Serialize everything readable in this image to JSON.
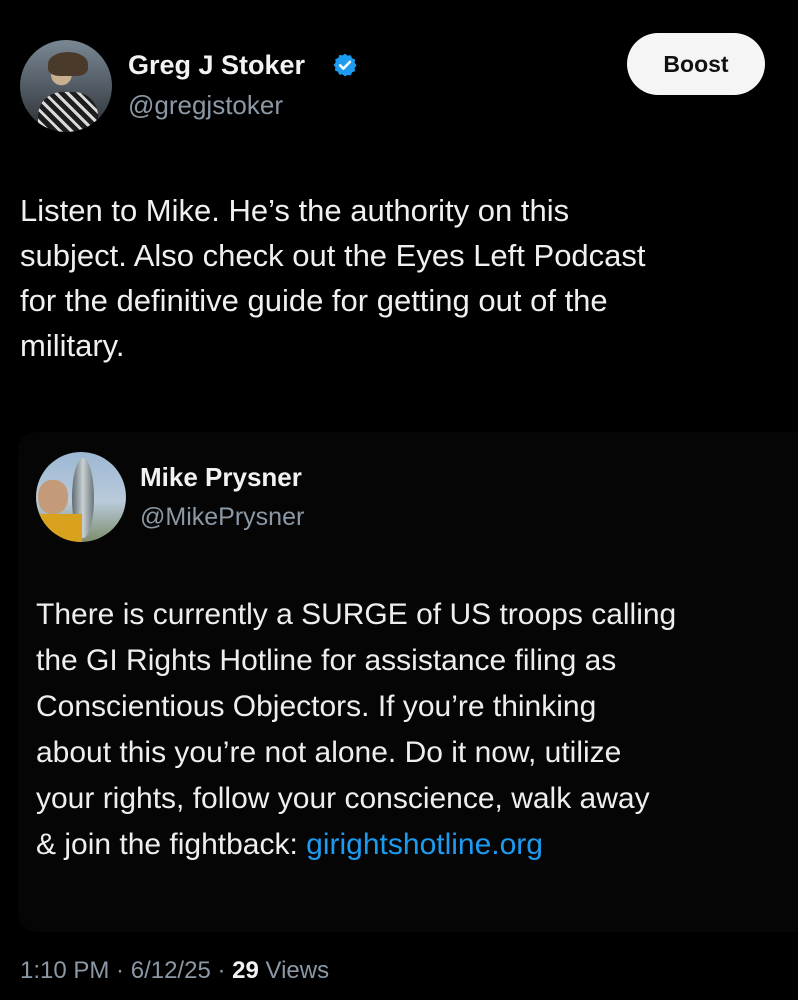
{
  "author": {
    "name": "Greg J Stoker",
    "handle": "@gregjstoker",
    "verified_color": "#1d9bf0"
  },
  "boost_label": "Boost",
  "post": {
    "text": "Listen to Mike. He’s the authority on this\nsubject. Also check out the Eyes Left Podcast\nfor the definitive guide for getting out of the\nmilitary."
  },
  "quote": {
    "name": "Mike Prysner",
    "handle": "@MikePrysner",
    "text": "There is currently a SURGE of US troops calling\nthe GI Rights Hotline for assistance filing as\nConscientious Objectors. If you’re thinking\nabout this you’re not alone. Do it now, utilize\nyour rights, follow your conscience, walk away\n& join the fightback: ",
    "link": "girightshotline.org",
    "link_color": "#1d9bf0"
  },
  "meta": {
    "time": "1:10 PM",
    "date": "6/12/25",
    "separator": " · ",
    "views_count": "29",
    "views_label": " Views"
  }
}
